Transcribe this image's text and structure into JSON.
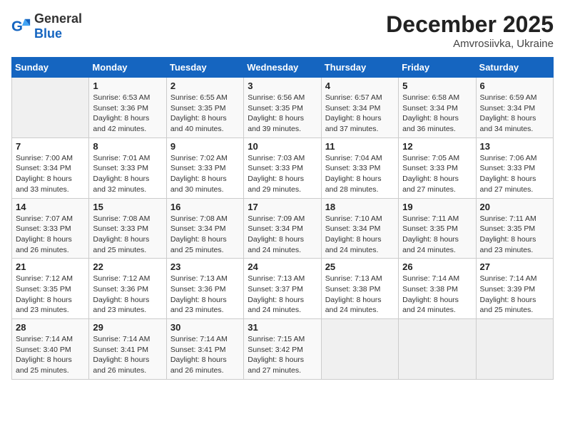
{
  "header": {
    "logo_general": "General",
    "logo_blue": "Blue",
    "month_year": "December 2025",
    "location": "Amvrosiivka, Ukraine"
  },
  "weekdays": [
    "Sunday",
    "Monday",
    "Tuesday",
    "Wednesday",
    "Thursday",
    "Friday",
    "Saturday"
  ],
  "weeks": [
    [
      {
        "day": "",
        "info": ""
      },
      {
        "day": "1",
        "info": "Sunrise: 6:53 AM\nSunset: 3:36 PM\nDaylight: 8 hours\nand 42 minutes."
      },
      {
        "day": "2",
        "info": "Sunrise: 6:55 AM\nSunset: 3:35 PM\nDaylight: 8 hours\nand 40 minutes."
      },
      {
        "day": "3",
        "info": "Sunrise: 6:56 AM\nSunset: 3:35 PM\nDaylight: 8 hours\nand 39 minutes."
      },
      {
        "day": "4",
        "info": "Sunrise: 6:57 AM\nSunset: 3:34 PM\nDaylight: 8 hours\nand 37 minutes."
      },
      {
        "day": "5",
        "info": "Sunrise: 6:58 AM\nSunset: 3:34 PM\nDaylight: 8 hours\nand 36 minutes."
      },
      {
        "day": "6",
        "info": "Sunrise: 6:59 AM\nSunset: 3:34 PM\nDaylight: 8 hours\nand 34 minutes."
      }
    ],
    [
      {
        "day": "7",
        "info": "Sunrise: 7:00 AM\nSunset: 3:34 PM\nDaylight: 8 hours\nand 33 minutes."
      },
      {
        "day": "8",
        "info": "Sunrise: 7:01 AM\nSunset: 3:33 PM\nDaylight: 8 hours\nand 32 minutes."
      },
      {
        "day": "9",
        "info": "Sunrise: 7:02 AM\nSunset: 3:33 PM\nDaylight: 8 hours\nand 30 minutes."
      },
      {
        "day": "10",
        "info": "Sunrise: 7:03 AM\nSunset: 3:33 PM\nDaylight: 8 hours\nand 29 minutes."
      },
      {
        "day": "11",
        "info": "Sunrise: 7:04 AM\nSunset: 3:33 PM\nDaylight: 8 hours\nand 28 minutes."
      },
      {
        "day": "12",
        "info": "Sunrise: 7:05 AM\nSunset: 3:33 PM\nDaylight: 8 hours\nand 27 minutes."
      },
      {
        "day": "13",
        "info": "Sunrise: 7:06 AM\nSunset: 3:33 PM\nDaylight: 8 hours\nand 27 minutes."
      }
    ],
    [
      {
        "day": "14",
        "info": "Sunrise: 7:07 AM\nSunset: 3:33 PM\nDaylight: 8 hours\nand 26 minutes."
      },
      {
        "day": "15",
        "info": "Sunrise: 7:08 AM\nSunset: 3:33 PM\nDaylight: 8 hours\nand 25 minutes."
      },
      {
        "day": "16",
        "info": "Sunrise: 7:08 AM\nSunset: 3:34 PM\nDaylight: 8 hours\nand 25 minutes."
      },
      {
        "day": "17",
        "info": "Sunrise: 7:09 AM\nSunset: 3:34 PM\nDaylight: 8 hours\nand 24 minutes."
      },
      {
        "day": "18",
        "info": "Sunrise: 7:10 AM\nSunset: 3:34 PM\nDaylight: 8 hours\nand 24 minutes."
      },
      {
        "day": "19",
        "info": "Sunrise: 7:11 AM\nSunset: 3:35 PM\nDaylight: 8 hours\nand 24 minutes."
      },
      {
        "day": "20",
        "info": "Sunrise: 7:11 AM\nSunset: 3:35 PM\nDaylight: 8 hours\nand 23 minutes."
      }
    ],
    [
      {
        "day": "21",
        "info": "Sunrise: 7:12 AM\nSunset: 3:35 PM\nDaylight: 8 hours\nand 23 minutes."
      },
      {
        "day": "22",
        "info": "Sunrise: 7:12 AM\nSunset: 3:36 PM\nDaylight: 8 hours\nand 23 minutes."
      },
      {
        "day": "23",
        "info": "Sunrise: 7:13 AM\nSunset: 3:36 PM\nDaylight: 8 hours\nand 23 minutes."
      },
      {
        "day": "24",
        "info": "Sunrise: 7:13 AM\nSunset: 3:37 PM\nDaylight: 8 hours\nand 24 minutes."
      },
      {
        "day": "25",
        "info": "Sunrise: 7:13 AM\nSunset: 3:38 PM\nDaylight: 8 hours\nand 24 minutes."
      },
      {
        "day": "26",
        "info": "Sunrise: 7:14 AM\nSunset: 3:38 PM\nDaylight: 8 hours\nand 24 minutes."
      },
      {
        "day": "27",
        "info": "Sunrise: 7:14 AM\nSunset: 3:39 PM\nDaylight: 8 hours\nand 25 minutes."
      }
    ],
    [
      {
        "day": "28",
        "info": "Sunrise: 7:14 AM\nSunset: 3:40 PM\nDaylight: 8 hours\nand 25 minutes."
      },
      {
        "day": "29",
        "info": "Sunrise: 7:14 AM\nSunset: 3:41 PM\nDaylight: 8 hours\nand 26 minutes."
      },
      {
        "day": "30",
        "info": "Sunrise: 7:14 AM\nSunset: 3:41 PM\nDaylight: 8 hours\nand 26 minutes."
      },
      {
        "day": "31",
        "info": "Sunrise: 7:15 AM\nSunset: 3:42 PM\nDaylight: 8 hours\nand 27 minutes."
      },
      {
        "day": "",
        "info": ""
      },
      {
        "day": "",
        "info": ""
      },
      {
        "day": "",
        "info": ""
      }
    ]
  ]
}
